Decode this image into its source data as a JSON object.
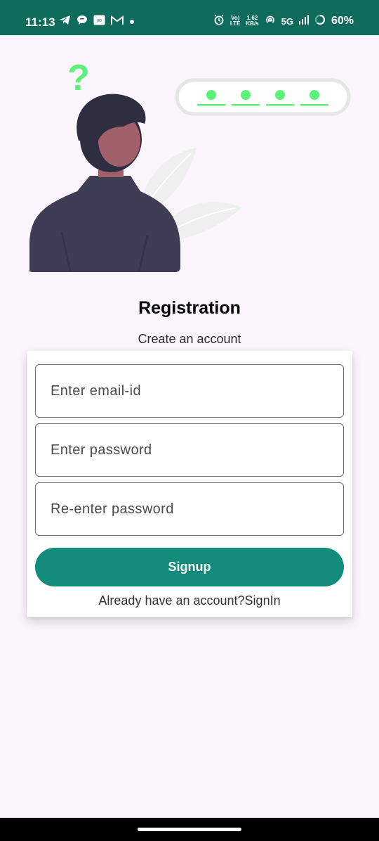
{
  "status_bar": {
    "time": "11:13",
    "volte_top": "Vo)",
    "volte_bottom": "LTE",
    "speed_top": "1.62",
    "speed_bottom": "KB/s",
    "network": "5G",
    "battery": "60%",
    "icons": [
      "telegram-icon",
      "chat-icon",
      "jio-app-icon",
      "gmail-icon",
      "dot-icon",
      "alarm-icon",
      "hotspot-icon",
      "signal-icon",
      "battery-icon"
    ]
  },
  "illustration": {
    "question_mark": "?",
    "password_dots_count": 4,
    "colors": {
      "accent_green": "#5cf27a",
      "jacket": "#3f3d56",
      "hair": "#2f2e41",
      "face": "#a0616a",
      "leaf": "#f2f2f2"
    }
  },
  "header": {
    "title": "Registration",
    "subtitle": "Create an account"
  },
  "form": {
    "email_placeholder": "Enter email-id",
    "password_placeholder": "Enter password",
    "confirm_placeholder": "Re-enter password",
    "signup_label": "Signup",
    "signin_text": "Already have an account?SignIn"
  },
  "theme": {
    "primary": "#138c7c",
    "status_bar": "#0f6b5c",
    "background": "#fcf5fd"
  }
}
